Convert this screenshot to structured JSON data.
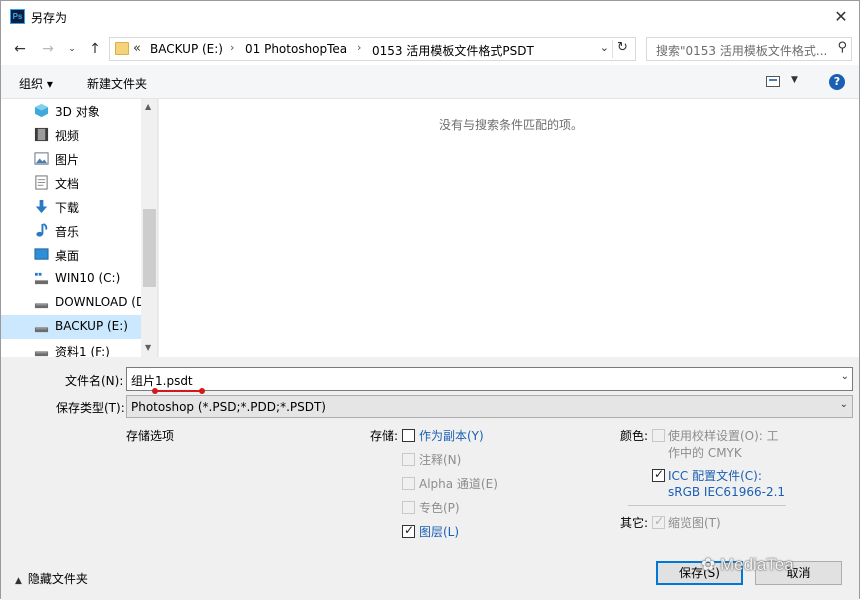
{
  "window": {
    "title": "另存为",
    "app_icon": "Ps"
  },
  "address": {
    "overflow": "«",
    "crumbs": [
      "BACKUP (E:)",
      "01 PhotoshopTea",
      "0153 活用模板文件格式PSDT"
    ],
    "search_placeholder": "搜索\"0153 活用模板文件格式..."
  },
  "toolbar": {
    "organize": "组织 ▾",
    "new_folder": "新建文件夹"
  },
  "nav": {
    "items": [
      {
        "label": "3D 对象",
        "icon": "3d-objects-icon"
      },
      {
        "label": "视频",
        "icon": "video-icon"
      },
      {
        "label": "图片",
        "icon": "pictures-icon"
      },
      {
        "label": "文档",
        "icon": "documents-icon"
      },
      {
        "label": "下载",
        "icon": "downloads-icon"
      },
      {
        "label": "音乐",
        "icon": "music-icon"
      },
      {
        "label": "桌面",
        "icon": "desktop-icon"
      },
      {
        "label": "WIN10 (C:)",
        "icon": "drive-icon"
      },
      {
        "label": "DOWNLOAD (D",
        "icon": "drive-icon"
      },
      {
        "label": "BACKUP (E:)",
        "icon": "drive-icon",
        "selected": true
      },
      {
        "label": "资料1 (F:)",
        "icon": "drive-icon"
      }
    ]
  },
  "file_view": {
    "empty_message": "没有与搜索条件匹配的项。"
  },
  "form": {
    "filename_label": "文件名(N):",
    "filename_value": "组片1.psdt",
    "filetype_label": "保存类型(T):",
    "filetype_value": "Photoshop (*.PSD;*.PDD;*.PSDT)",
    "save_options_title": "存储选项",
    "storage_label": "存储:",
    "storage_options": [
      {
        "label": "作为副本(Y)",
        "checked": false,
        "enabled": true
      },
      {
        "label": "注释(N)",
        "checked": false,
        "enabled": false
      },
      {
        "label": "Alpha 通道(E)",
        "checked": false,
        "enabled": false
      },
      {
        "label": "专色(P)",
        "checked": false,
        "enabled": false
      },
      {
        "label": "图层(L)",
        "checked": true,
        "enabled": true
      }
    ],
    "color_label": "颜色:",
    "color_proof_line1": "使用校样设置(O): 工",
    "color_proof_line2": "作中的 CMYK",
    "icc_line1": "ICC 配置文件(C):",
    "icc_line2": "sRGB IEC61966-2.1",
    "other_label": "其它:",
    "thumbnail_label": "缩览图(T)",
    "hide_folders": "隐藏文件夹",
    "save_button": "保存(S)",
    "cancel_button": "取消"
  },
  "watermark": "MediaTea",
  "colors": {
    "accent": "#0078d7",
    "link": "#1a5fb4",
    "selected": "#cce8ff",
    "annotation_red": "#d11a1a"
  }
}
